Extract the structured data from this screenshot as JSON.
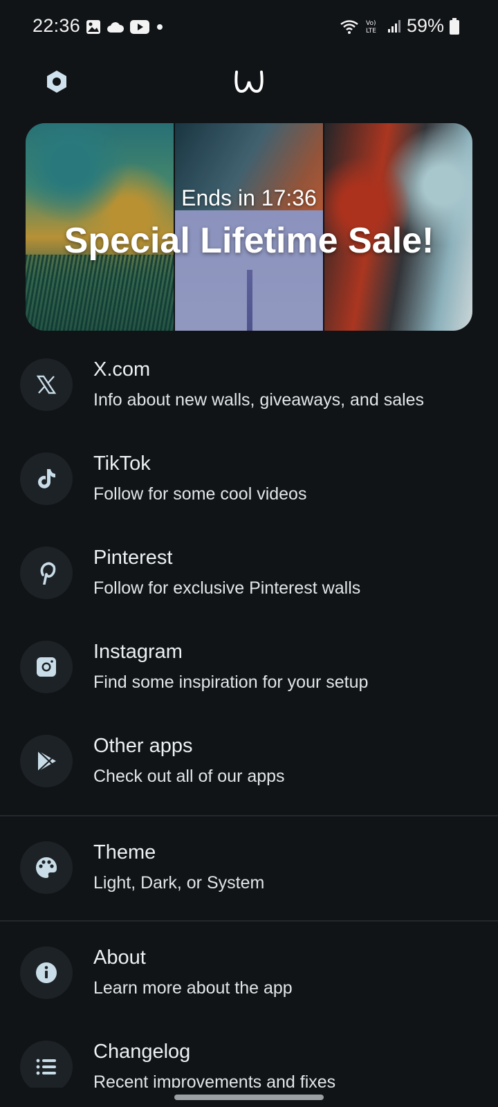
{
  "status_bar": {
    "time": "22:36",
    "battery": "59%",
    "left_icons": [
      "gallery-icon",
      "cloud-icon",
      "youtube-icon",
      "dot-icon"
    ],
    "right_icons": [
      "wifi-icon",
      "volte-icon",
      "signal-icon",
      "battery-icon"
    ]
  },
  "header": {
    "settings_icon": "hexagon-settings-icon",
    "logo_icon": "app-logo-w"
  },
  "banner": {
    "subtitle": "Ends in 17:36",
    "title": "Special Lifetime Sale!"
  },
  "items": [
    {
      "title": "X.com",
      "subtitle": "Info about new walls, giveaways, and sales",
      "icon": "x-icon"
    },
    {
      "title": "TikTok",
      "subtitle": "Follow for some cool videos",
      "icon": "tiktok-icon"
    },
    {
      "title": "Pinterest",
      "subtitle": "Follow for exclusive Pinterest walls",
      "icon": "pinterest-icon"
    },
    {
      "title": "Instagram",
      "subtitle": "Find some inspiration for your setup",
      "icon": "instagram-icon"
    },
    {
      "title": "Other apps",
      "subtitle": "Check out all of our apps",
      "icon": "play-store-icon"
    },
    {
      "title": "Theme",
      "subtitle": "Light, Dark, or System",
      "icon": "palette-icon"
    },
    {
      "title": "About",
      "subtitle": "Learn more about the app",
      "icon": "info-icon"
    },
    {
      "title": "Changelog",
      "subtitle": "Recent improvements and fixes",
      "icon": "list-icon"
    }
  ],
  "colors": {
    "background": "#111417",
    "icon_circle": "#1d2226",
    "icon_fg": "#c9dde8",
    "text": "#eef1f3"
  }
}
